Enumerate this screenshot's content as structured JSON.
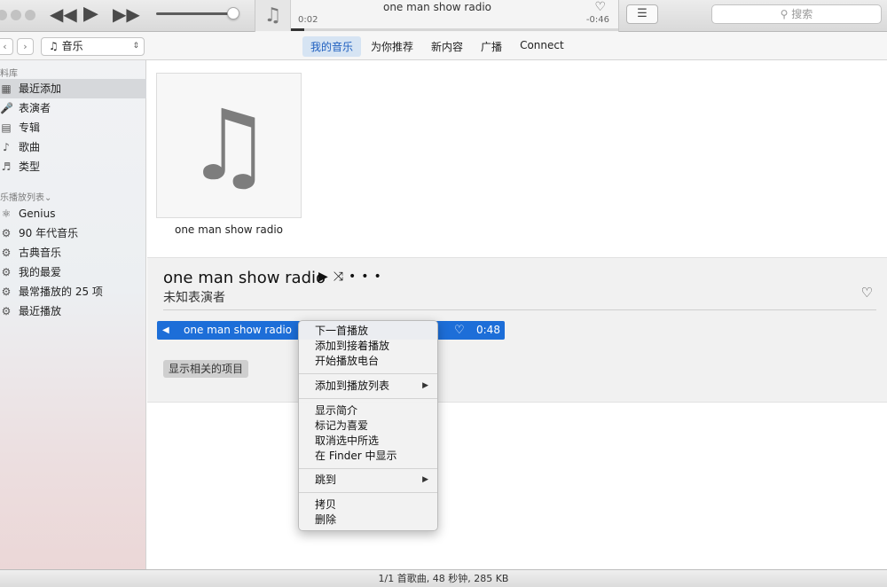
{
  "player": {
    "prev_icon": "rewind-icon",
    "play_icon": "play-icon",
    "next_icon": "fast-forward-icon",
    "now_playing_title": "one man show radio",
    "elapsed": "0:02",
    "remaining": "-0:46",
    "progress": 0.04,
    "volume": 0.9
  },
  "search": {
    "placeholder": "搜索"
  },
  "nav": {
    "source": "音乐",
    "tabs": [
      {
        "label": "我的音乐",
        "active": true
      },
      {
        "label": "为你推荐",
        "active": false
      },
      {
        "label": "新内容",
        "active": false
      },
      {
        "label": "广播",
        "active": false
      },
      {
        "label": "Connect",
        "active": false
      }
    ]
  },
  "sidebar": {
    "library_header": "料库",
    "library_items": [
      {
        "label": "最近添加",
        "icon": "grid-icon",
        "selected": true
      },
      {
        "label": "表演者",
        "icon": "microphone-icon",
        "selected": false
      },
      {
        "label": "专辑",
        "icon": "album-icon",
        "selected": false
      },
      {
        "label": "歌曲",
        "icon": "note-icon",
        "selected": false
      },
      {
        "label": "类型",
        "icon": "genre-icon",
        "selected": false
      }
    ],
    "playlists_header": "乐播放列表",
    "playlist_items": [
      {
        "label": "Genius",
        "icon": "atom-icon"
      },
      {
        "label": "90 年代音乐",
        "icon": "gear-icon"
      },
      {
        "label": "古典音乐",
        "icon": "gear-icon"
      },
      {
        "label": "我的最爱",
        "icon": "gear-icon"
      },
      {
        "label": "最常播放的 25 项",
        "icon": "gear-icon"
      },
      {
        "label": "最近播放",
        "icon": "gear-icon"
      }
    ]
  },
  "main": {
    "album_caption": "one man show radio",
    "detail_title": "one man show radio",
    "detail_artist": "未知表演者",
    "track": {
      "name": "one man show radio",
      "duration": "0:48"
    },
    "related_button": "显示相关的项目"
  },
  "menu": {
    "group1": [
      "下一首播放",
      "添加到接着播放",
      "开始播放电台"
    ],
    "group2": [
      "添加到播放列表"
    ],
    "group3": [
      "显示简介",
      "标记为喜爱",
      "取消选中所选",
      "在 Finder 中显示"
    ],
    "group4": [
      "跳到"
    ],
    "group5": [
      "拷贝",
      "删除"
    ]
  },
  "status": {
    "text": "1/1 首歌曲, 48 秒钟, 285 KB"
  },
  "colors": {
    "accent": "#1d6ed8",
    "tab_active_bg": "#d6e4f3",
    "tab_active_text": "#1f5fbf"
  }
}
